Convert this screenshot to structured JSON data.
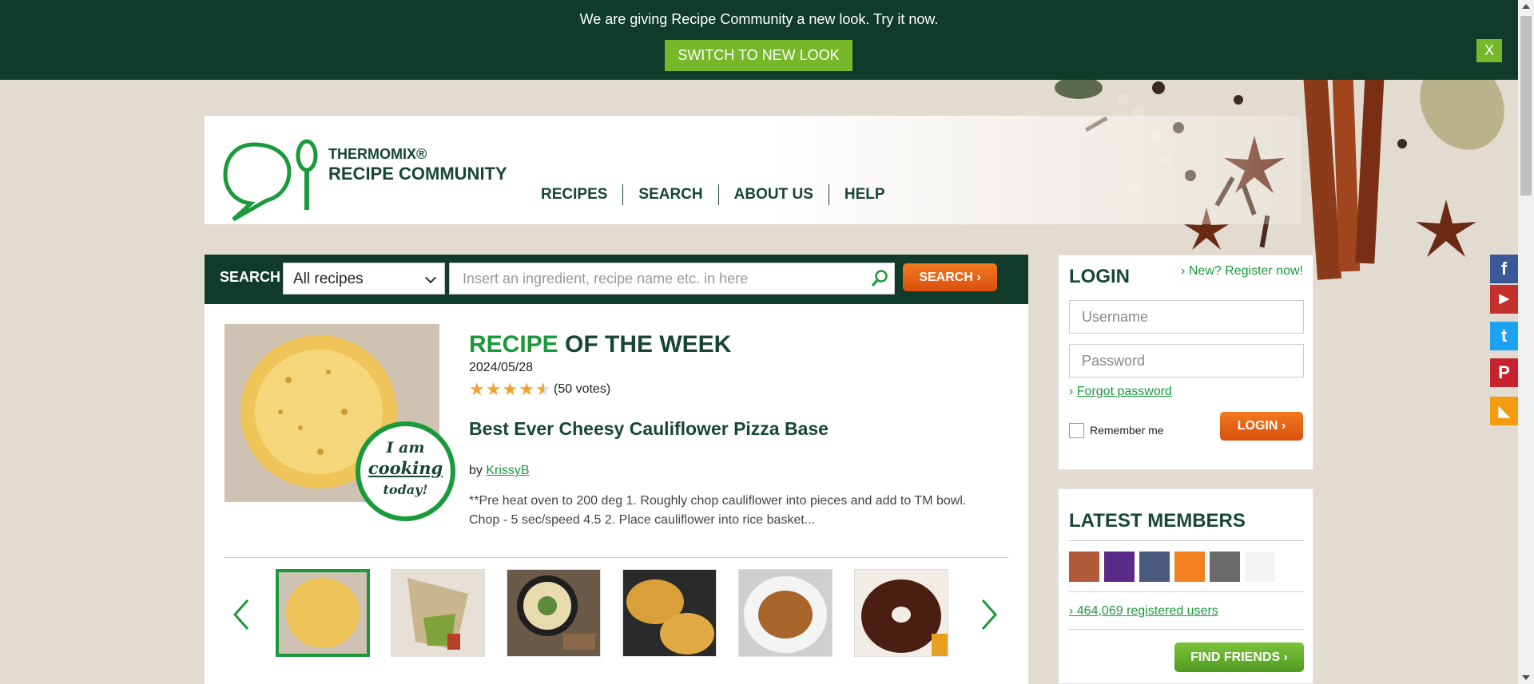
{
  "banner": {
    "text": "We are giving Recipe Community a new look. Try it now.",
    "switch_label": "SWITCH TO NEW LOOK",
    "close_label": "X"
  },
  "header": {
    "brand_line1": "THERMOMIX®",
    "brand_line2": "RECIPE COMMUNITY",
    "nav": [
      {
        "label": "RECIPES"
      },
      {
        "label": "SEARCH"
      },
      {
        "label": "ABOUT US"
      },
      {
        "label": "HELP"
      }
    ]
  },
  "search": {
    "label": "SEARCH",
    "scope_selected": "All recipes",
    "placeholder": "Insert an ingredient, recipe name etc. in here",
    "button_label": "SEARCH"
  },
  "recipe_of_week": {
    "title_accent": "RECIPE",
    "title_rest": "OF THE WEEK",
    "date": "2024/05/28",
    "rating": 4.5,
    "votes": "(50 votes)",
    "name": "Best Ever Cheesy Cauliflower Pizza Base",
    "by_label": "by",
    "author": "KrissyB",
    "description": "**Pre heat oven to 200 deg 1. Roughly chop cauliflower into pieces and add to TM bowl. Chop - 5 sec/speed 4.5 2. Place cauliflower into rice basket...",
    "badge_line1": "I am",
    "badge_line2": "cooking",
    "badge_line3": "today!"
  },
  "carousel": {
    "thumbs": [
      {
        "name": "thumb-cauliflower-pizza",
        "color": "#e8b54a"
      },
      {
        "name": "thumb-wrap",
        "color": "#c9b58e"
      },
      {
        "name": "thumb-soup",
        "color": "#5a4a3a"
      },
      {
        "name": "thumb-fritters",
        "color": "#d9a03a"
      },
      {
        "name": "thumb-curry",
        "color": "#a8652a"
      },
      {
        "name": "thumb-bundt-cake",
        "color": "#4a1f12"
      }
    ]
  },
  "login": {
    "title": "LOGIN",
    "register_label": "New? Register now!",
    "username_placeholder": "Username",
    "password_placeholder": "Password",
    "forgot_label": "Forgot password",
    "remember_label": "Remember me",
    "login_button": "LOGIN"
  },
  "members": {
    "title": "LATEST MEMBERS",
    "count_label": "464,069 registered users",
    "find_button": "FIND FRIENDS",
    "avatars": [
      {
        "color": "#b05a3a"
      },
      {
        "color": "#5a2a8a"
      },
      {
        "color": "#4a5a7a"
      },
      {
        "color": "#f08020"
      },
      {
        "color": "#6a6a6a"
      },
      {
        "color": "#f4f4f4"
      }
    ]
  },
  "social": [
    {
      "name": "facebook-icon",
      "color": "#3b5998",
      "glyph": "f"
    },
    {
      "name": "youtube-icon",
      "color": "#c4302b",
      "glyph": "▶"
    },
    {
      "name": "twitter-icon",
      "color": "#1da1f2",
      "glyph": "t"
    },
    {
      "name": "pinterest-icon",
      "color": "#c8232c",
      "glyph": "P"
    },
    {
      "name": "rss-icon",
      "color": "#f39c12",
      "glyph": "◣"
    }
  ]
}
